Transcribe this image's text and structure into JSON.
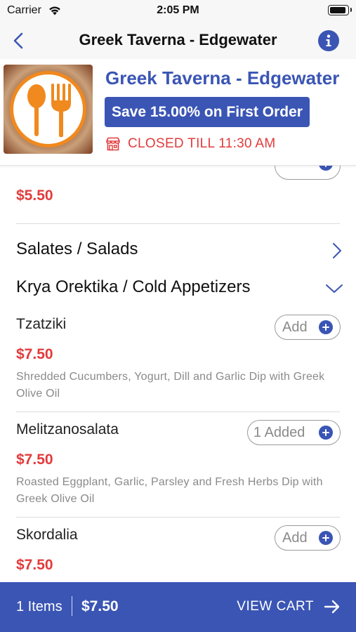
{
  "status_bar": {
    "carrier": "Carrier",
    "time": "2:05 PM",
    "battery_level": 0.9
  },
  "nav": {
    "title": "Greek Taverna - Edgewater",
    "back_icon": "chevron-left-icon",
    "info_icon": "info-icon"
  },
  "restaurant": {
    "name": "Greek Taverna - Edgewater",
    "promo": "Save 15.00% on First Order",
    "status": "CLOSED TILL 11:30 AM",
    "logo_icon": "spoon-fork-logo"
  },
  "menu": {
    "previous_item_price": "$5.50",
    "categories": [
      {
        "label": "Salates / Salads",
        "expanded": false
      },
      {
        "label": "Krya Orektika / Cold Appetizers",
        "expanded": true
      }
    ],
    "items": [
      {
        "name": "Tzatziki",
        "price": "$7.50",
        "description": "Shredded Cucumbers, Yogurt, Dill and Garlic Dip with Greek Olive Oil",
        "button": "Add"
      },
      {
        "name": "Melitzanosalata",
        "price": "$7.50",
        "description": "Roasted Eggplant, Garlic, Parsley and Fresh Herbs Dip with Greek Olive Oil",
        "button": "1 Added"
      },
      {
        "name": "Skordalia",
        "price": "$7.50",
        "button": "Add"
      }
    ]
  },
  "cart": {
    "count": "1 Items",
    "total": "$7.50",
    "action": "VIEW CART"
  },
  "colors": {
    "brand": "#3a55b4",
    "price": "#e23b3b",
    "logo_orange": "#f0891e"
  }
}
